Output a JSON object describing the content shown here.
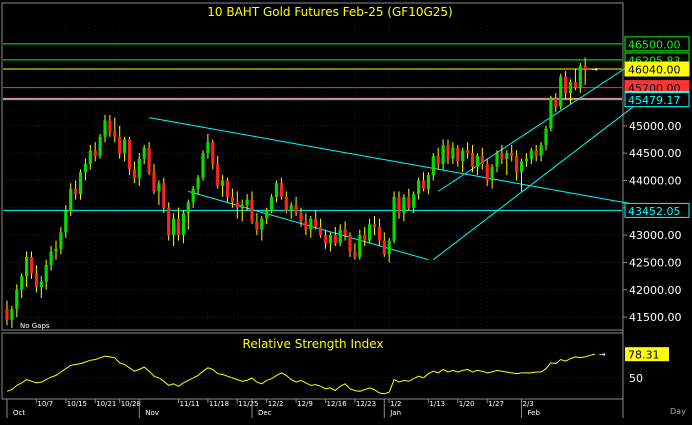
{
  "chart_data": [
    {
      "type": "candlestick",
      "title": "10 BAHT  Gold Futures Feb-25  (GF10G25)",
      "note": "No Gaps",
      "ylim": [
        41300,
        46900
      ],
      "yticks": [
        41500,
        42000,
        42500,
        43000,
        43500,
        44000,
        44500,
        45000
      ],
      "ytick_labels": [
        "41500.00",
        "42000.00",
        "42500.00",
        "43000.00",
        "43500.00",
        "44000.00",
        "44500.00",
        "45000.00"
      ],
      "levels": [
        {
          "value": 46500,
          "label": "46500.00",
          "color": "#00ff00",
          "fill": "#000000",
          "text": "#00ff00"
        },
        {
          "value": 46205.83,
          "label": "46205.83",
          "color": "#00ff00",
          "fill": "#000000",
          "text": "#00ff00"
        },
        {
          "value": 46040,
          "label": "46040.00",
          "color": "#ffff00",
          "fill": "#ffff00",
          "text": "#000000"
        },
        {
          "value": 45700,
          "label": "45700.00",
          "color": "#ff3333",
          "fill": "#ff3333",
          "text": "#000000"
        },
        {
          "value": 45501.67,
          "label": "45501.67",
          "color": "#ff9999",
          "fill": "#ffb0b0",
          "text": "#000000"
        },
        {
          "value": 45479.17,
          "label": "45479.17",
          "color": "#00ffff",
          "fill": "#000000",
          "text": "#00ffff"
        },
        {
          "value": 43452.05,
          "label": "43452.05",
          "color": "#00ffff",
          "fill": "#000000",
          "text": "#00ffff"
        }
      ],
      "trendlines": [
        {
          "name": "down-channel-upper",
          "points": [
            [
              29,
              45150
            ],
            [
              135,
              43452.05
            ]
          ]
        },
        {
          "name": "down-channel-lower",
          "points": [
            [
              37,
              43800
            ],
            [
              86,
              42550
            ]
          ]
        },
        {
          "name": "up-channel-upper",
          "points": [
            [
              88,
              43800
            ],
            [
              129,
              46220
            ]
          ]
        },
        {
          "name": "up-channel-lower",
          "points": [
            [
              87,
              42550
            ],
            [
              130,
              45500
            ]
          ]
        }
      ],
      "x_labels": [
        {
          "label": "10/7",
          "x": 6
        },
        {
          "label": "10/15",
          "x": 12
        },
        {
          "label": "10/21",
          "x": 18
        },
        {
          "label": "10/28",
          "x": 23
        },
        {
          "label": "11/11",
          "x": 35
        },
        {
          "label": "11/18",
          "x": 41
        },
        {
          "label": "11/25",
          "x": 47
        },
        {
          "label": "12/2",
          "x": 53
        },
        {
          "label": "12/9",
          "x": 59
        },
        {
          "label": "12/16",
          "x": 65
        },
        {
          "label": "12/23",
          "x": 71
        },
        {
          "label": "1/2",
          "x": 78
        },
        {
          "label": "1/13",
          "x": 86
        },
        {
          "label": "1/20",
          "x": 92
        },
        {
          "label": "1/27",
          "x": 98
        },
        {
          "label": "2/3",
          "x": 105
        }
      ],
      "month_labels": [
        {
          "label": "Oct",
          "x": 0
        },
        {
          "label": "Nov",
          "x": 27
        },
        {
          "label": "Dec",
          "x": 50
        },
        {
          "label": "Jan",
          "x": 77
        },
        {
          "label": "Feb",
          "x": 105
        }
      ],
      "ohlc": [
        [
          41650,
          41800,
          41350,
          41450
        ],
        [
          41450,
          41700,
          41300,
          41650
        ],
        [
          41650,
          42100,
          41500,
          42000
        ],
        [
          42000,
          42300,
          41850,
          42250
        ],
        [
          42250,
          42700,
          42050,
          42600
        ],
        [
          42600,
          42700,
          42200,
          42300
        ],
        [
          42300,
          42450,
          41950,
          42050
        ],
        [
          42050,
          42250,
          41850,
          42150
        ],
        [
          42150,
          42550,
          42000,
          42450
        ],
        [
          42450,
          42800,
          42350,
          42700
        ],
        [
          42700,
          42900,
          42550,
          42750
        ],
        [
          42750,
          43150,
          42650,
          43050
        ],
        [
          43050,
          43550,
          42950,
          43450
        ],
        [
          43450,
          43950,
          43350,
          43850
        ],
        [
          43850,
          44000,
          43650,
          43750
        ],
        [
          43750,
          44200,
          43650,
          44150
        ],
        [
          44150,
          44400,
          44000,
          44300
        ],
        [
          44300,
          44650,
          44200,
          44550
        ],
        [
          44550,
          44700,
          44350,
          44450
        ],
        [
          44450,
          44850,
          44400,
          44800
        ],
        [
          44800,
          45200,
          44700,
          45100
        ],
        [
          45100,
          45200,
          44800,
          44900
        ],
        [
          44900,
          45150,
          44700,
          44800
        ],
        [
          44800,
          45000,
          44400,
          44500
        ],
        [
          44500,
          44800,
          44350,
          44750
        ],
        [
          44750,
          44800,
          44100,
          44200
        ],
        [
          44200,
          44350,
          43950,
          44050
        ],
        [
          44050,
          44500,
          43900,
          44400
        ],
        [
          44400,
          44650,
          44300,
          44600
        ],
        [
          44600,
          44700,
          44100,
          44150
        ],
        [
          44150,
          44300,
          43750,
          43800
        ],
        [
          43800,
          44000,
          43550,
          43950
        ],
        [
          43950,
          44050,
          43400,
          43500
        ],
        [
          43500,
          43600,
          42900,
          43000
        ],
        [
          43000,
          43400,
          42800,
          43300
        ],
        [
          43300,
          43500,
          42900,
          43000
        ],
        [
          43000,
          43450,
          42850,
          43400
        ],
        [
          43400,
          43650,
          43100,
          43600
        ],
        [
          43600,
          43900,
          43500,
          43850
        ],
        [
          43850,
          44100,
          43750,
          44050
        ],
        [
          44050,
          44550,
          44000,
          44500
        ],
        [
          44500,
          44850,
          44400,
          44700
        ],
        [
          44700,
          44750,
          44200,
          44300
        ],
        [
          44300,
          44450,
          43850,
          43900
        ],
        [
          43900,
          44100,
          43700,
          44000
        ],
        [
          44000,
          44050,
          43600,
          43700
        ],
        [
          43700,
          43850,
          43500,
          43600
        ],
        [
          43600,
          43800,
          43300,
          43500
        ],
        [
          43500,
          43650,
          43250,
          43550
        ],
        [
          43550,
          43750,
          43450,
          43650
        ],
        [
          43650,
          43800,
          43200,
          43250
        ],
        [
          43250,
          43400,
          43000,
          43100
        ],
        [
          43100,
          43350,
          42900,
          43300
        ],
        [
          43300,
          43500,
          43200,
          43450
        ],
        [
          43450,
          43750,
          43400,
          43700
        ],
        [
          43700,
          44000,
          43600,
          43950
        ],
        [
          43950,
          44050,
          43650,
          43700
        ],
        [
          43700,
          43800,
          43400,
          43450
        ],
        [
          43450,
          43600,
          43300,
          43550
        ],
        [
          43550,
          43700,
          43350,
          43400
        ],
        [
          43400,
          43500,
          43150,
          43250
        ],
        [
          43250,
          43400,
          43000,
          43100
        ],
        [
          43100,
          43350,
          42950,
          43300
        ],
        [
          43300,
          43450,
          43100,
          43150
        ],
        [
          43150,
          43300,
          42950,
          43000
        ],
        [
          43000,
          43100,
          42750,
          42850
        ],
        [
          42850,
          43050,
          42700,
          43000
        ],
        [
          43000,
          43150,
          42800,
          42850
        ],
        [
          42850,
          43200,
          42800,
          43100
        ],
        [
          43100,
          43250,
          42900,
          43000
        ],
        [
          43000,
          43050,
          42600,
          42700
        ],
        [
          42700,
          42850,
          42550,
          42600
        ],
        [
          42600,
          43100,
          42550,
          43000
        ],
        [
          43000,
          43150,
          42800,
          42900
        ],
        [
          42900,
          43300,
          42850,
          43200
        ],
        [
          43200,
          43350,
          43000,
          43150
        ],
        [
          43150,
          43300,
          42800,
          42900
        ],
        [
          42900,
          43050,
          42600,
          42650
        ],
        [
          42650,
          42950,
          42500,
          42900
        ],
        [
          42900,
          43800,
          42850,
          43700
        ],
        [
          43700,
          43800,
          43300,
          43400
        ],
        [
          43400,
          43750,
          43250,
          43700
        ],
        [
          43700,
          43850,
          43450,
          43500
        ],
        [
          43500,
          43800,
          43400,
          43750
        ],
        [
          43750,
          44050,
          43650,
          44000
        ],
        [
          44000,
          44150,
          43800,
          43850
        ],
        [
          43850,
          44150,
          43750,
          44100
        ],
        [
          44100,
          44500,
          44000,
          44450
        ],
        [
          44450,
          44600,
          44200,
          44300
        ],
        [
          44300,
          44750,
          44200,
          44650
        ],
        [
          44650,
          44750,
          44300,
          44400
        ],
        [
          44400,
          44700,
          44300,
          44600
        ],
        [
          44600,
          44650,
          44250,
          44350
        ],
        [
          44350,
          44600,
          44150,
          44550
        ],
        [
          44550,
          44700,
          44400,
          44500
        ],
        [
          44500,
          44650,
          44150,
          44250
        ],
        [
          44250,
          44500,
          44100,
          44450
        ],
        [
          44450,
          44600,
          44200,
          44300
        ],
        [
          44300,
          44400,
          43900,
          44000
        ],
        [
          44000,
          44300,
          43850,
          44250
        ],
        [
          44250,
          44550,
          44150,
          44500
        ],
        [
          44500,
          44650,
          44300,
          44400
        ],
        [
          44400,
          44550,
          44100,
          44500
        ],
        [
          44500,
          44650,
          44350,
          44450
        ],
        [
          44450,
          44550,
          44000,
          44150
        ],
        [
          44150,
          44400,
          43800,
          44350
        ],
        [
          44350,
          44500,
          44250,
          44400
        ],
        [
          44400,
          44600,
          44300,
          44550
        ],
        [
          44550,
          44650,
          44350,
          44450
        ],
        [
          44450,
          44700,
          44350,
          44650
        ],
        [
          44650,
          45000,
          44550,
          44950
        ],
        [
          44950,
          45550,
          44900,
          45500
        ],
        [
          45500,
          45600,
          45250,
          45350
        ],
        [
          45350,
          45950,
          45300,
          45900
        ],
        [
          45900,
          46000,
          45500,
          45600
        ],
        [
          45600,
          45850,
          45400,
          45800
        ],
        [
          45800,
          46050,
          45650,
          45700
        ],
        [
          45700,
          46150,
          45600,
          46100
        ],
        [
          46100,
          46250,
          45750,
          46040
        ]
      ]
    },
    {
      "type": "line",
      "title": "Relative Strength Index",
      "name": "RSI",
      "ylim": [
        26,
        100
      ],
      "yticks": [
        50
      ],
      "last_label": "78.31",
      "day_label": "Day",
      "values": [
        34,
        36,
        41,
        44,
        48,
        46,
        44,
        45,
        48,
        51,
        53,
        57,
        61,
        65,
        66,
        67,
        69,
        71,
        72,
        74,
        76,
        75,
        74,
        68,
        66,
        62,
        58,
        60,
        63,
        58,
        52,
        50,
        46,
        41,
        43,
        40,
        44,
        47,
        50,
        53,
        58,
        62,
        60,
        55,
        54,
        52,
        50,
        48,
        46,
        47,
        50,
        45,
        43,
        47,
        49,
        53,
        56,
        53,
        48,
        45,
        47,
        44,
        41,
        42,
        40,
        37,
        38,
        35,
        40,
        43,
        37,
        35,
        34,
        36,
        38,
        36,
        32,
        31,
        33,
        48,
        45,
        47,
        46,
        49,
        52,
        50,
        55,
        58,
        56,
        60,
        57,
        59,
        57,
        59,
        60,
        57,
        59,
        58,
        56,
        57,
        59,
        58,
        57,
        56,
        55,
        56,
        56,
        56,
        57,
        57,
        61,
        68,
        67,
        72,
        70,
        73,
        75,
        74,
        75,
        77,
        78.31
      ]
    }
  ]
}
